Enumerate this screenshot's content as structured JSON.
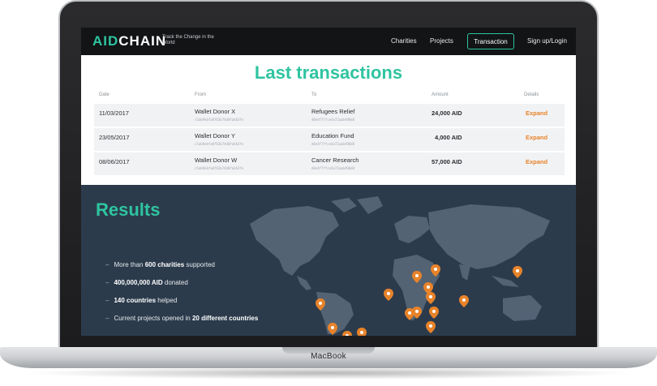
{
  "device": {
    "brand": "MacBook"
  },
  "nav": {
    "logo_prefix": "AID",
    "logo_suffix": "CHAIN",
    "tagline": "Track the Change in the World",
    "links": [
      "Charities",
      "Projects"
    ],
    "active_button": "Transaction",
    "auth": "Sign up/Login"
  },
  "transactions": {
    "title": "Last transactions",
    "columns": [
      "Date",
      "From",
      "To",
      "Amount",
      "Details"
    ],
    "rows": [
      {
        "date": "11/03/2017",
        "from": "Wallet Donor X",
        "from_addr": "c5ab9ebfa0f63b74d0fab63fe",
        "to": "Refugees Relief",
        "to_addr": "d8e4f7ffce4a72aab490d0",
        "amount": "24,000 AID",
        "details": "Expand"
      },
      {
        "date": "23/05/2017",
        "from": "Wallet Donor Y",
        "from_addr": "c5ab9ebfa0f63b74d0fab63fe",
        "to": "Education Fund",
        "to_addr": "d8e4f7ffce4a72aab490d0",
        "amount": "4,000 AID",
        "details": "Expand"
      },
      {
        "date": "08/06/2017",
        "from": "Wallet Donor W",
        "from_addr": "c5ab9ebfa0f63b74d0fab63fe",
        "to": "Cancer Research",
        "to_addr": "d8e4f7ffce4a72aab490d0",
        "amount": "57,000 AID",
        "details": "Expand"
      }
    ]
  },
  "results": {
    "title": "Results",
    "items": [
      {
        "pre": "More than ",
        "bold": "600 charities",
        "post": " supported"
      },
      {
        "pre": "",
        "bold": "400,000,000 AID",
        "post": " donated"
      },
      {
        "pre": "",
        "bold": "140 countries",
        "post": " helped"
      },
      {
        "pre": "Current projects opened in ",
        "bold": "20 different countries",
        "post": ""
      }
    ]
  },
  "colors": {
    "accent": "#2ec4a0",
    "pin": "#e8832a",
    "results_bg": "#2c3b4c",
    "nav_bg": "#121416"
  },
  "icons": {
    "map_pin": "map-pin-icon"
  }
}
